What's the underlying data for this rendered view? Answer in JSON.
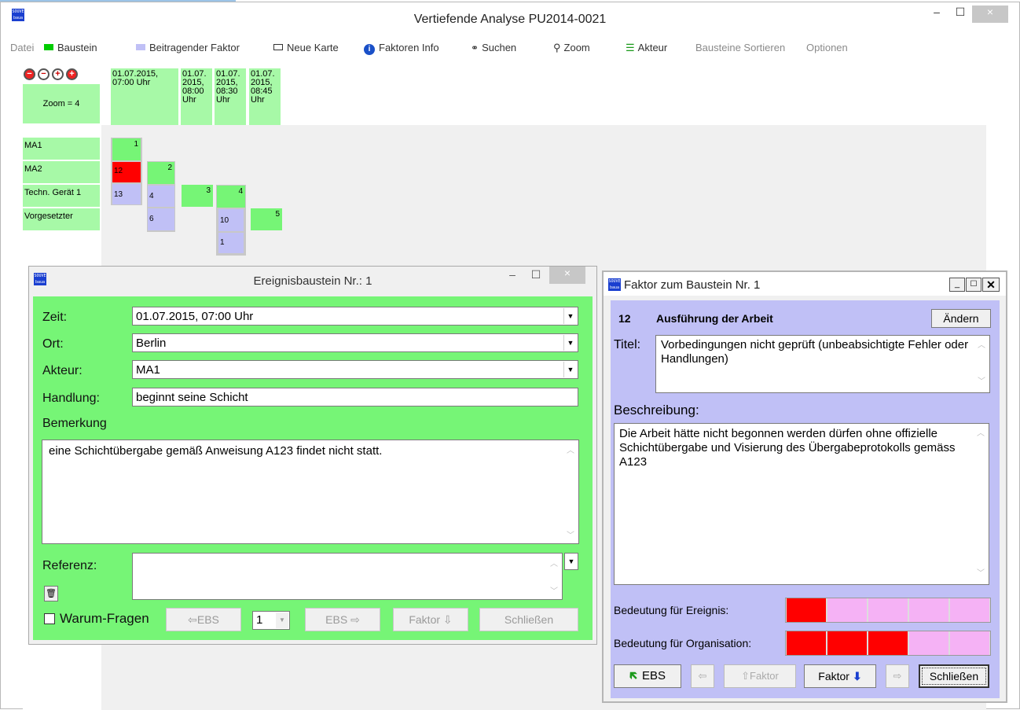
{
  "window": {
    "title": "Vertiefende Analyse PU2014-0021",
    "app_icon": "SOUVE baua",
    "minimize": "–",
    "maximize": "☐",
    "close": "×"
  },
  "menu": {
    "datei": "Datei",
    "baustein": "Baustein",
    "beitragender_faktor": "Beitragender Faktor",
    "neue_karte": "Neue Karte",
    "faktoren_info": "Faktoren Info",
    "suchen": "Suchen",
    "zoom": "Zoom",
    "akteur": "Akteur",
    "bausteine_sortieren": "Bausteine Sortieren",
    "optionen": "Optionen"
  },
  "colors": {
    "green": "#a7f9a7",
    "dialog_green": "#76f576",
    "lavender": "#c0c0f6",
    "red": "#ff0000",
    "pink": "#f5b2f5",
    "accent_blue": "#1a3fd0"
  },
  "zoom_label": "Zoom = 4",
  "times": [
    "01.07.2015, 07:00 Uhr",
    "01.07. 2015, 08:00 Uhr",
    "01.07. 2015, 08:30 Uhr",
    "01.07. 2015, 08:45 Uhr"
  ],
  "actors": [
    "MA1",
    "MA2",
    "Techn. Gerät 1",
    "Vorgesetzter"
  ],
  "blocks": {
    "b1": "1",
    "b2": "2",
    "b3": "3",
    "b4": "4",
    "b5": "5",
    "f12": "12",
    "f13": "13",
    "f4": "4",
    "f6": "6",
    "f10": "10",
    "f1": "1"
  },
  "event_dialog": {
    "title": "Ereignisbaustein Nr.: 1",
    "zeit_label": "Zeit:",
    "zeit_value": "01.07.2015, 07:00 Uhr",
    "ort_label": "Ort:",
    "ort_value": "Berlin",
    "akteur_label": "Akteur:",
    "akteur_value": "MA1",
    "handlung_label": "Handlung:",
    "handlung_value": "beginnt seine Schicht",
    "bemerkung_label": "Bemerkung",
    "bemerkung_value": "eine Schichtübergabe gemäß Anweisung A123 findet nicht statt.",
    "referenz_label": "Referenz:",
    "referenz_value": "",
    "warum_label": "Warum-Fragen",
    "btn_ebs_prev": "⇦EBS",
    "step_value": "1",
    "btn_ebs_next": "EBS ⇨",
    "btn_faktor": "Faktor ⇩",
    "btn_close": "Schließen"
  },
  "factor_dialog": {
    "title": "Faktor zum Baustein Nr. 1",
    "number": "12",
    "heading": "Ausführung der Arbeit",
    "btn_aendern": "Ändern",
    "titel_label": "Titel:",
    "titel_value": "Vorbedingungen nicht geprüft (unbeabsichtigte Fehler oder Handlungen)",
    "beschreibung_label": "Beschreibung:",
    "beschreibung_value": "Die Arbeit hätte nicht begonnen werden dürfen ohne offizielle Schichtübergabe und Visierung des Übergabeprotokolls gemäss A123",
    "bedeutung_ereignis_label": "Bedeutung für Ereignis:",
    "bedeutung_ereignis_level": 1,
    "bedeutung_org_label": "Bedeutung für Organisation:",
    "bedeutung_org_level": 3,
    "scale_max": 5,
    "btn_ebs": "EBS",
    "btn_prev": "⇦",
    "btn_faktor_up": "⇧Faktor",
    "btn_faktor": "Faktor",
    "btn_next": "⇨",
    "btn_close": "Schließen"
  }
}
